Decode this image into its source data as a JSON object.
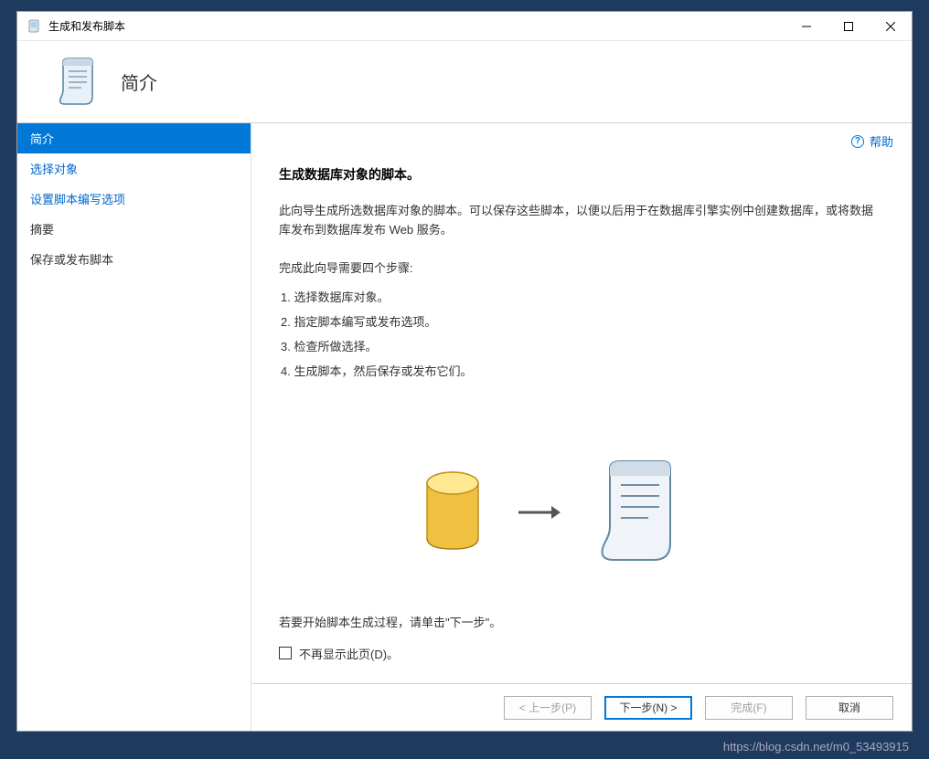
{
  "window": {
    "title": "生成和发布脚本"
  },
  "header": {
    "title": "简介"
  },
  "sidebar": {
    "items": [
      {
        "label": "简介",
        "active": true
      },
      {
        "label": "选择对象",
        "link": true
      },
      {
        "label": "设置脚本编写选项",
        "link": true
      },
      {
        "label": "摘要",
        "link": false
      },
      {
        "label": "保存或发布脚本",
        "link": false
      }
    ]
  },
  "help": {
    "label": "帮助"
  },
  "main": {
    "heading": "生成数据库对象的脚本。",
    "description": "此向导生成所选数据库对象的脚本。可以保存这些脚本，以便以后用于在数据库引擎实例中创建数据库，或将数据库发布到数据库发布 Web 服务。",
    "steps_intro": "完成此向导需要四个步骤:",
    "steps": [
      "1. 选择数据库对象。",
      "2. 指定脚本编写或发布选项。",
      "3. 检查所做选择。",
      "4. 生成脚本，然后保存或发布它们。"
    ],
    "start_hint": "若要开始脚本生成过程，请单击\"下一步\"。",
    "checkbox_label": "不再显示此页(D)。"
  },
  "buttons": {
    "prev": "< 上一步(P)",
    "next": "下一步(N) >",
    "finish": "完成(F)",
    "cancel": "取消"
  },
  "watermark": "https://blog.csdn.net/m0_53493915"
}
